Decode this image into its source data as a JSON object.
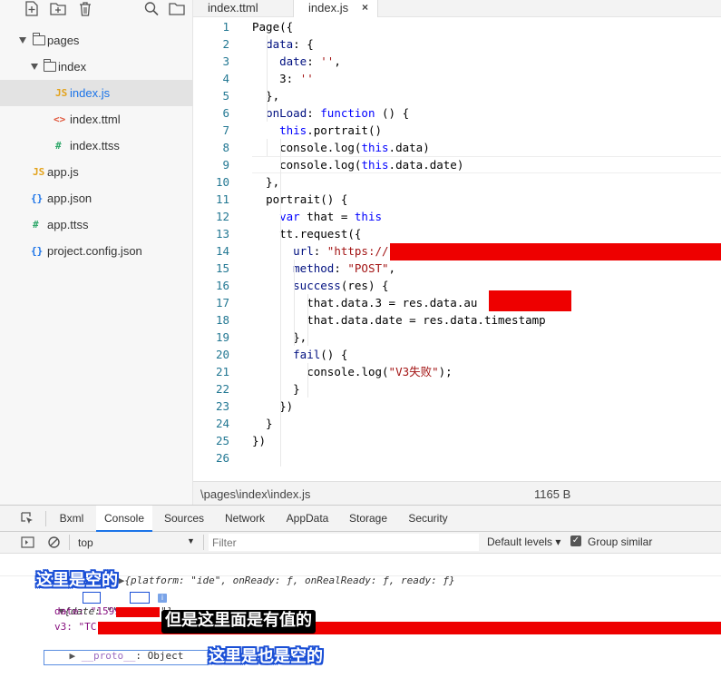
{
  "sidebar": {
    "toolbar_icons": [
      "new-file-icon",
      "new-folder-icon",
      "delete-icon",
      "search-icon",
      "open-folder-icon"
    ],
    "tree": [
      {
        "label": "pages",
        "type": "folder",
        "expanded": true
      },
      {
        "label": "index",
        "type": "folder",
        "expanded": true
      },
      {
        "label": "index.js",
        "type": "js",
        "icon_text": "JS",
        "active": true
      },
      {
        "label": "index.ttml",
        "type": "ttml",
        "icon_text": "<>"
      },
      {
        "label": "index.ttss",
        "type": "ttss",
        "icon_text": "#"
      },
      {
        "label": "app.js",
        "type": "js",
        "icon_text": "JS"
      },
      {
        "label": "app.json",
        "type": "json",
        "icon_text": "{}"
      },
      {
        "label": "app.ttss",
        "type": "ttss",
        "icon_text": "#"
      },
      {
        "label": "project.config.json",
        "type": "json",
        "icon_text": "{}"
      }
    ]
  },
  "editor": {
    "tabs": [
      {
        "label": "index.ttml",
        "active": false
      },
      {
        "label": "index.js",
        "active": true,
        "close": "×"
      }
    ],
    "line_numbers": [
      "1",
      "2",
      "3",
      "4",
      "5",
      "6",
      "7",
      "8",
      "9",
      "10",
      "11",
      "12",
      "13",
      "14",
      "15",
      "16",
      "17",
      "18",
      "19",
      "20",
      "21",
      "22",
      "23",
      "24",
      "25",
      "26"
    ],
    "code": [
      "Page({",
      "  data: {",
      "    date: '',",
      "    v3: ''",
      "  },",
      "  onLoad: function () {",
      "    this.portrait()",
      "    console.log(this.data)",
      "    console.log(this.data.date)",
      "  },",
      "  portrait() {",
      "    var that = this",
      "    tt.request({",
      "      url: \"https://",
      "      method: \"POST\",",
      "      success(res) {",
      "        that.data.v3 = res.data.au",
      "        that.data.date = res.data.timestamp",
      "      },",
      "      fail() {",
      "        console.log(\"V3失败\");",
      "      }",
      "    })",
      "  }",
      "})",
      ""
    ],
    "status_path": "\\pages\\index\\index.js",
    "status_size": "1165 B"
  },
  "devtools": {
    "tabs": [
      "Bxml",
      "Console",
      "Sources",
      "Network",
      "AppData",
      "Storage",
      "Security"
    ],
    "active_tab": "Console",
    "context": "top",
    "filter_placeholder": "Filter",
    "levels": "Default levels ▾",
    "group_similar": "Group similar",
    "console_lines": {
      "line1_prefix": "TMAConfig ",
      "line1_obj": "{platform: \"ide\", onReady: ƒ, onRealReady: ƒ, ready: ƒ}",
      "line2": "{date: \"\", v3: \"\"}",
      "line3": "date: \"1599",
      "line4": "v3: \"TC",
      "line5_key": "__proto__",
      "line5_val": ": Object",
      "info_badge": "i"
    }
  },
  "annotations": {
    "a1": "这里是空的",
    "a2": "但是这里面是有值的",
    "a3": "这里是也是空的"
  },
  "colors": {
    "redact": "#ee0000",
    "annotation_outline": "#1a4fd6",
    "keyword": "#0000ff",
    "string": "#a31515",
    "line_number": "#237893",
    "active_tab_underline": "#1a73e8"
  }
}
